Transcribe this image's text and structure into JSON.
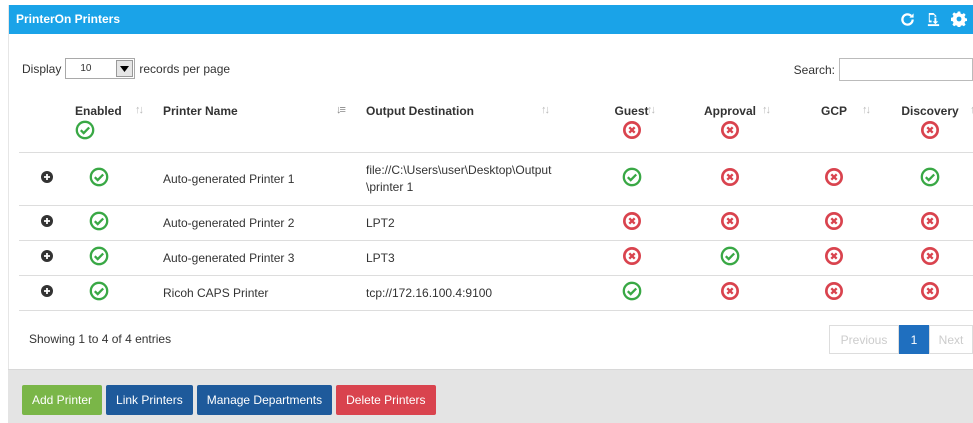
{
  "header": {
    "title": "PrinterOn Printers",
    "icons": [
      "refresh-icon",
      "import-icon",
      "gear-icon"
    ]
  },
  "controls": {
    "display_label": "Display",
    "page_size": "10",
    "records_label": "records per page",
    "search_label": "Search:",
    "search_value": ""
  },
  "table": {
    "columns": [
      "Enabled",
      "Printer Name",
      "Output Destination",
      "Guest",
      "Approval",
      "GCP",
      "Discovery"
    ],
    "header_status": {
      "enabled": "on",
      "guest": "off",
      "approval": "off",
      "discovery": "off"
    },
    "rows": [
      {
        "name": "Auto-generated Printer 1",
        "dest": "file://C:\\Users\\user\\Desktop\\Output",
        "dest2": "\\printer 1",
        "enabled": "on",
        "guest": "on",
        "approval": "off",
        "gcp": "off",
        "discovery": "on"
      },
      {
        "name": "Auto-generated Printer 2",
        "dest": "LPT2",
        "dest2": "",
        "enabled": "on",
        "guest": "off",
        "approval": "off",
        "gcp": "off",
        "discovery": "off"
      },
      {
        "name": "Auto-generated Printer 3",
        "dest": "LPT3",
        "dest2": "",
        "enabled": "on",
        "guest": "off",
        "approval": "on",
        "gcp": "off",
        "discovery": "off"
      },
      {
        "name": "Ricoh CAPS Printer",
        "dest": "tcp://172.16.100.4:9100",
        "dest2": "",
        "enabled": "on",
        "guest": "on",
        "approval": "off",
        "gcp": "off",
        "discovery": "off"
      }
    ]
  },
  "info": "Showing 1 to 4 of 4 entries",
  "pagination": {
    "previous": "Previous",
    "current": "1",
    "next": "Next"
  },
  "buttons": {
    "add": "Add Printer",
    "link": "Link Printers",
    "manage": "Manage Departments",
    "delete": "Delete Printers"
  },
  "colors": {
    "header": "#1aa3e8",
    "on": "#39a845",
    "off": "#d9434e",
    "add": "#7ab648",
    "link": "#1e5a9b",
    "delete": "#d9434e"
  }
}
